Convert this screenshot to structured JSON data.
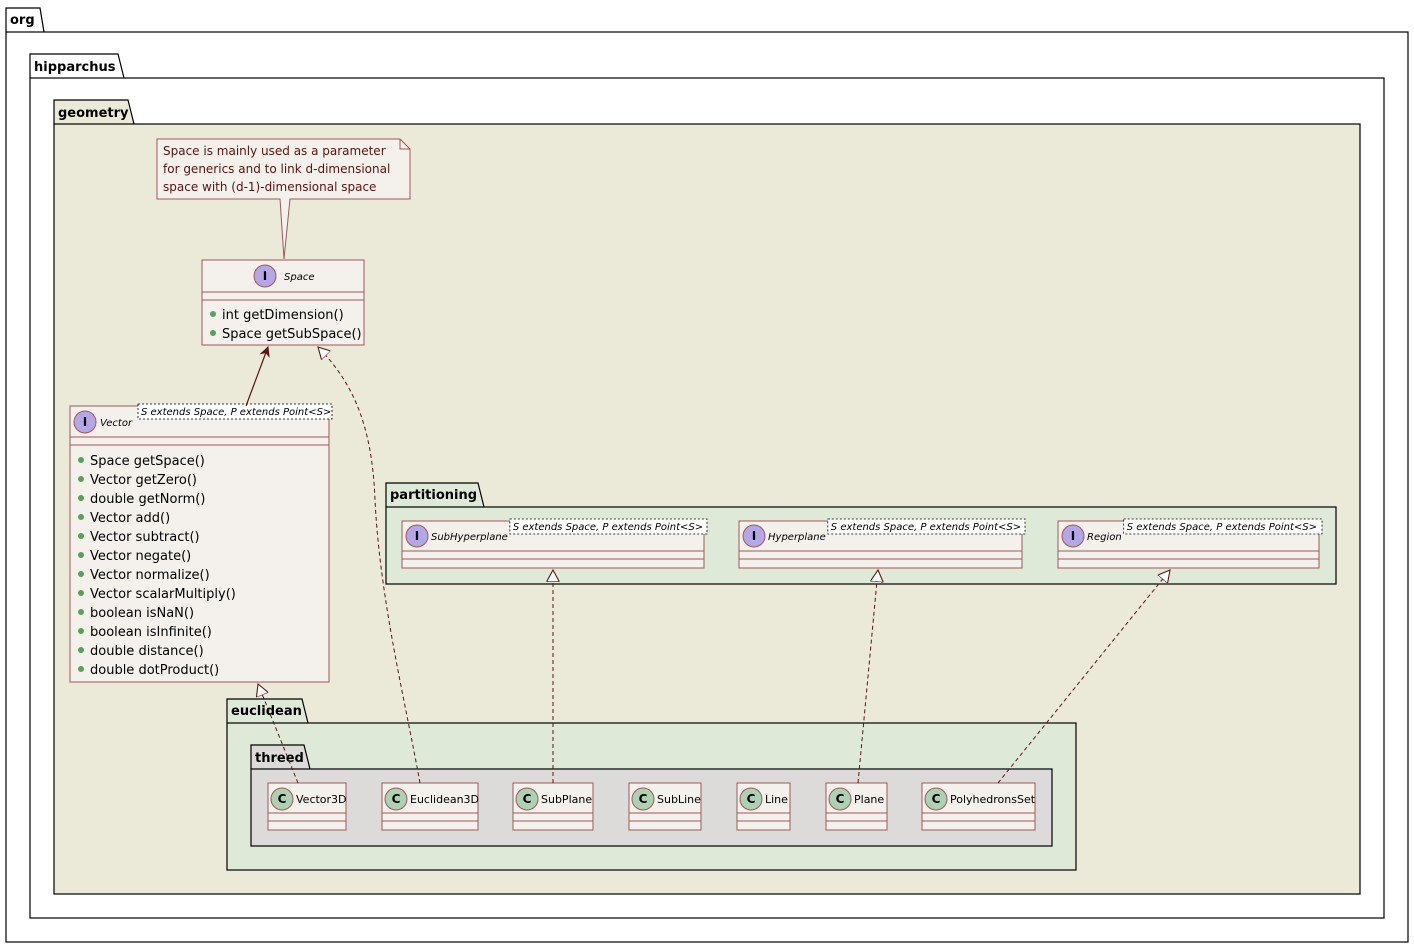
{
  "packages": {
    "org": "org",
    "hipparchus": "hipparchus",
    "geometry": "geometry",
    "partitioning": "partitioning",
    "euclidean": "euclidean",
    "threed": "threed"
  },
  "note": {
    "lines": [
      "Space is mainly used as a parameter",
      "for generics and to link d-dimensional",
      "space with (d-1)-dimensional space"
    ]
  },
  "space": {
    "badge": "I",
    "name": "Space",
    "members": [
      "int getDimension()",
      "Space getSubSpace()"
    ]
  },
  "vector": {
    "badge": "I",
    "name": "Vector",
    "generic": "S extends Space, P extends Point<S>",
    "members": [
      "Space getSpace()",
      "Vector getZero()",
      "double getNorm()",
      "Vector add()",
      "Vector subtract()",
      "Vector negate()",
      "Vector normalize()",
      "Vector scalarMultiply()",
      "boolean isNaN()",
      "boolean isInfinite()",
      "double distance()",
      "double dotProduct()"
    ]
  },
  "partitioning_items": [
    {
      "badge": "I",
      "name": "SubHyperplane",
      "generic": "S extends Space, P extends Point<S>"
    },
    {
      "badge": "I",
      "name": "Hyperplane",
      "generic": "S extends Space, P extends Point<S>"
    },
    {
      "badge": "I",
      "name": "Region",
      "generic": "S extends Space, P extends Point<S>"
    }
  ],
  "threed_classes": [
    {
      "badge": "C",
      "name": "Vector3D"
    },
    {
      "badge": "C",
      "name": "Euclidean3D"
    },
    {
      "badge": "C",
      "name": "SubPlane"
    },
    {
      "badge": "C",
      "name": "SubLine"
    },
    {
      "badge": "C",
      "name": "Line"
    },
    {
      "badge": "C",
      "name": "Plane"
    },
    {
      "badge": "C",
      "name": "PolyhedronsSet"
    }
  ],
  "colors": {
    "geometry_bg": "#ebe9d8",
    "sub_pkg_bg": "#dfe9d8",
    "threed_bg": "#dddbd9",
    "class_bg": "#f4f1ec",
    "class_border": "#a0585a",
    "interface_badge": "#b4a7e5",
    "class_badge": "#add1b2",
    "arrow": "#5a1414",
    "member_dot": "#5aa05a"
  }
}
